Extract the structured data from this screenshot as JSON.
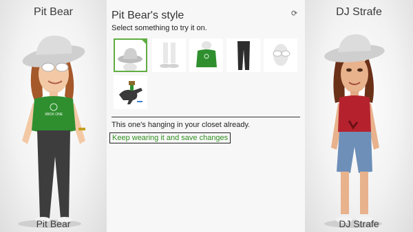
{
  "left_panel": {
    "name": "Pit Bear",
    "footer": "Pit Bear",
    "shirt_logo": "XBOX ONE"
  },
  "right_panel": {
    "name": "DJ Strafe",
    "footer": "DJ Strafe"
  },
  "center": {
    "title": "Pit Bear's style",
    "subtitle": "Select something to try it on.",
    "items": [
      {
        "icon": "hat-icon",
        "selected": true
      },
      {
        "icon": "shoes-icon",
        "selected": false
      },
      {
        "icon": "shirt-icon",
        "selected": false
      },
      {
        "icon": "pants-icon",
        "selected": false
      },
      {
        "icon": "glasses-icon",
        "selected": false
      },
      {
        "icon": "prop-dinosaur-icon",
        "selected": false
      }
    ],
    "message": "This one's hanging in your closet already.",
    "action_label": "Keep wearing it and save changes"
  },
  "colors": {
    "accent": "#5fad41",
    "shirt_green": "#2f8f2f",
    "shirt_red": "#b5222e"
  }
}
